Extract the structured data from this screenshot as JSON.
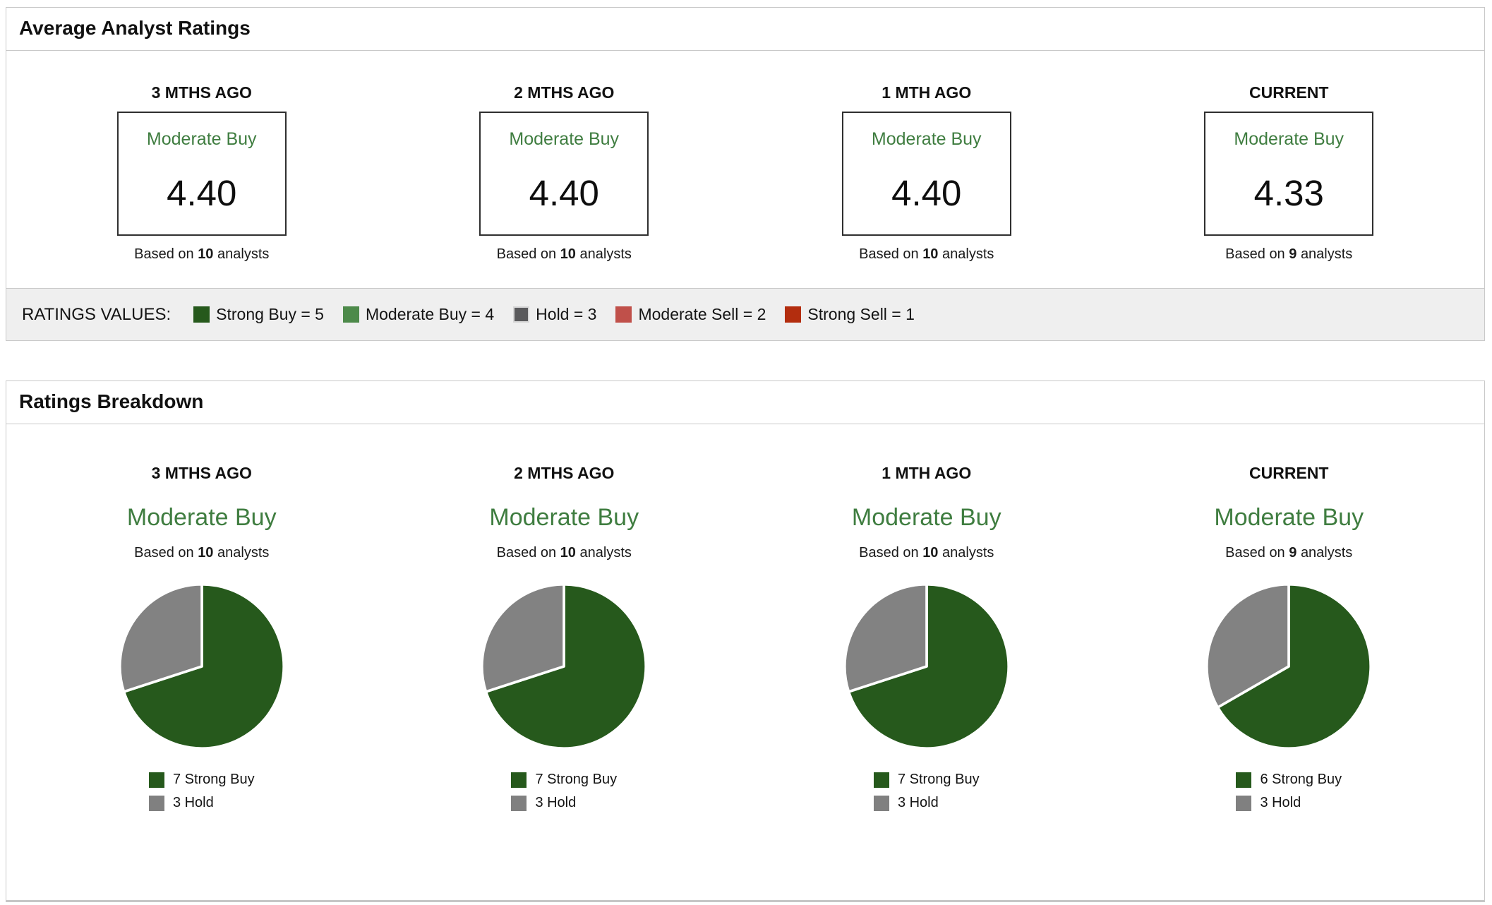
{
  "average_panel": {
    "title": "Average Analyst Ratings",
    "columns": [
      {
        "period": "3 MTHS AGO",
        "rating": "Moderate Buy",
        "score": "4.40",
        "based_prefix": "Based on",
        "analyst_count": "10",
        "based_suffix": "analysts"
      },
      {
        "period": "2 MTHS AGO",
        "rating": "Moderate Buy",
        "score": "4.40",
        "based_prefix": "Based on",
        "analyst_count": "10",
        "based_suffix": "analysts"
      },
      {
        "period": "1 MTH AGO",
        "rating": "Moderate Buy",
        "score": "4.40",
        "based_prefix": "Based on",
        "analyst_count": "10",
        "based_suffix": "analysts"
      },
      {
        "period": "CURRENT",
        "rating": "Moderate Buy",
        "score": "4.33",
        "based_prefix": "Based on",
        "analyst_count": "9",
        "based_suffix": "analysts"
      }
    ],
    "ratings_values": {
      "label": "RATINGS VALUES:",
      "items": [
        {
          "label": "Strong Buy = 5",
          "color": "#26591c"
        },
        {
          "label": "Moderate Buy = 4",
          "color": "#4d8a4a"
        },
        {
          "label": "Hold = 3",
          "color": "#5a5a5c"
        },
        {
          "label": "Moderate Sell = 2",
          "color": "#c0504a"
        },
        {
          "label": "Strong Sell = 1",
          "color": "#b32d0e"
        }
      ]
    }
  },
  "breakdown_panel": {
    "title": "Ratings Breakdown",
    "columns": [
      {
        "period": "3 MTHS AGO",
        "rating": "Moderate Buy",
        "based_prefix": "Based on",
        "analyst_count": "10",
        "based_suffix": "analysts",
        "pie": {
          "values": [
            7,
            3
          ],
          "colors": [
            "#26591c",
            "#828282"
          ]
        },
        "legend": [
          {
            "label": "7 Strong Buy",
            "color": "#26591c"
          },
          {
            "label": "3 Hold",
            "color": "#808080"
          }
        ]
      },
      {
        "period": "2 MTHS AGO",
        "rating": "Moderate Buy",
        "based_prefix": "Based on",
        "analyst_count": "10",
        "based_suffix": "analysts",
        "pie": {
          "values": [
            7,
            3
          ],
          "colors": [
            "#26591c",
            "#828282"
          ]
        },
        "legend": [
          {
            "label": "7 Strong Buy",
            "color": "#26591c"
          },
          {
            "label": "3 Hold",
            "color": "#808080"
          }
        ]
      },
      {
        "period": "1 MTH AGO",
        "rating": "Moderate Buy",
        "based_prefix": "Based on",
        "analyst_count": "10",
        "based_suffix": "analysts",
        "pie": {
          "values": [
            7,
            3
          ],
          "colors": [
            "#26591c",
            "#828282"
          ]
        },
        "legend": [
          {
            "label": "7 Strong Buy",
            "color": "#26591c"
          },
          {
            "label": "3 Hold",
            "color": "#808080"
          }
        ]
      },
      {
        "period": "CURRENT",
        "rating": "Moderate Buy",
        "based_prefix": "Based on",
        "analyst_count": "9",
        "based_suffix": "analysts",
        "pie": {
          "values": [
            6,
            3
          ],
          "colors": [
            "#26591c",
            "#828282"
          ]
        },
        "legend": [
          {
            "label": "6 Strong Buy",
            "color": "#26591c"
          },
          {
            "label": "3 Hold",
            "color": "#808080"
          }
        ]
      }
    ]
  },
  "theme": {
    "rating_text_green": "#3f7d40",
    "strong_buy_green": "#26591c",
    "moderate_buy_green": "#4d8a4a",
    "hold_gray": "#828282",
    "moderate_sell_red": "#c0504a",
    "strong_sell_red": "#b32d0e",
    "panel_border": "#c9c9c9",
    "strip_background": "#efefef"
  },
  "chart_data": [
    {
      "type": "table",
      "title": "Average Analyst Ratings",
      "columns": [
        "3 MTHS AGO",
        "2 MTHS AGO",
        "1 MTH AGO",
        "CURRENT"
      ],
      "rows": [
        [
          "Moderate Buy",
          "Moderate Buy",
          "Moderate Buy",
          "Moderate Buy"
        ],
        [
          "4.40",
          "4.40",
          "4.40",
          "4.33"
        ],
        [
          "Based on 10 analysts",
          "Based on 10 analysts",
          "Based on 10 analysts",
          "Based on 9 analysts"
        ]
      ],
      "rating_scale": {
        "Strong Buy": 5,
        "Moderate Buy": 4,
        "Hold": 3,
        "Moderate Sell": 2,
        "Strong Sell": 1
      }
    },
    {
      "type": "pie",
      "title": "3 MTHS AGO",
      "subtitle": "Moderate Buy",
      "labels": [
        "Strong Buy",
        "Hold"
      ],
      "values": [
        7,
        3
      ],
      "colors": [
        "#26591c",
        "#828282"
      ],
      "start_angle": "12 o'clock",
      "direction": "clockwise",
      "legend_position": "bottom"
    },
    {
      "type": "pie",
      "title": "2 MTHS AGO",
      "subtitle": "Moderate Buy",
      "labels": [
        "Strong Buy",
        "Hold"
      ],
      "values": [
        7,
        3
      ],
      "colors": [
        "#26591c",
        "#828282"
      ],
      "start_angle": "12 o'clock",
      "direction": "clockwise",
      "legend_position": "bottom"
    },
    {
      "type": "pie",
      "title": "1 MTH AGO",
      "subtitle": "Moderate Buy",
      "labels": [
        "Strong Buy",
        "Hold"
      ],
      "values": [
        7,
        3
      ],
      "colors": [
        "#26591c",
        "#828282"
      ],
      "start_angle": "12 o'clock",
      "direction": "clockwise",
      "legend_position": "bottom"
    },
    {
      "type": "pie",
      "title": "CURRENT",
      "subtitle": "Moderate Buy",
      "labels": [
        "Strong Buy",
        "Hold"
      ],
      "values": [
        6,
        3
      ],
      "colors": [
        "#26591c",
        "#828282"
      ],
      "start_angle": "12 o'clock",
      "direction": "clockwise",
      "legend_position": "bottom"
    }
  ]
}
